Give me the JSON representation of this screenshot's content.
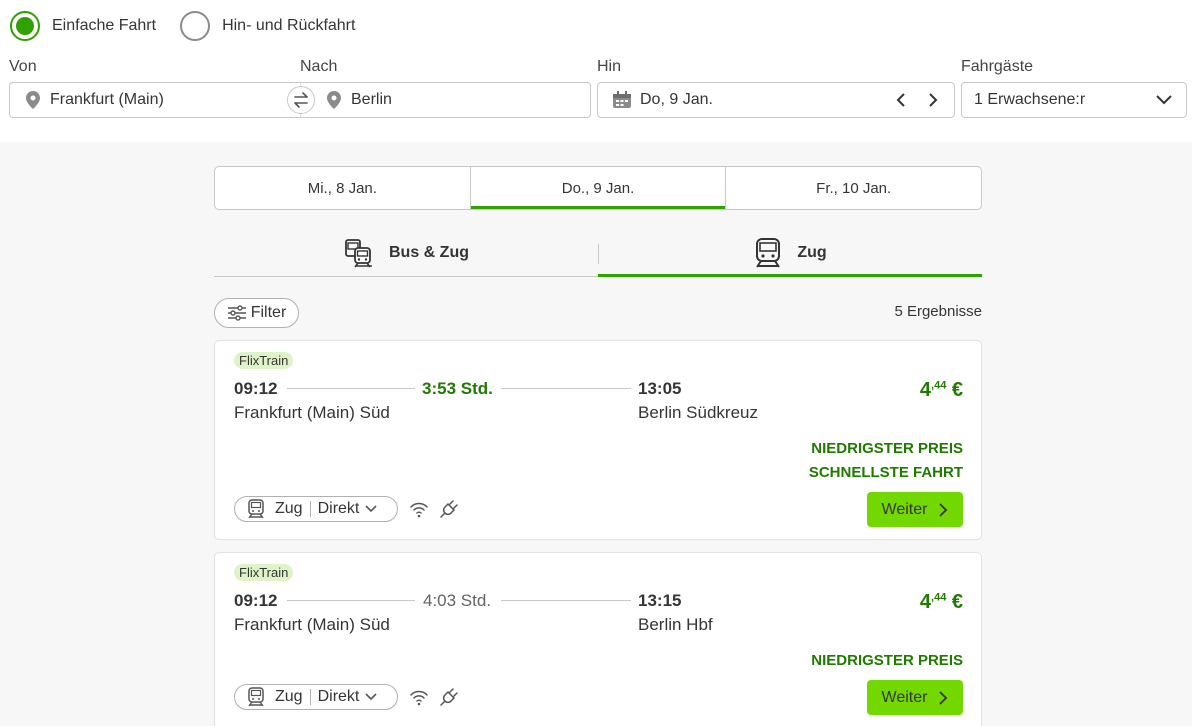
{
  "trip_type": {
    "options": [
      {
        "label": "Einfache Fahrt",
        "checked": true
      },
      {
        "label": "Hin- und Rückfahrt",
        "checked": false
      }
    ]
  },
  "search": {
    "from_label": "Von",
    "from_value": "Frankfurt (Main)",
    "to_label": "Nach",
    "to_value": "Berlin",
    "date_label": "Hin",
    "date_value": "Do, 9 Jan.",
    "passengers_label": "Fahrgäste",
    "passengers_value": "1 Erwachsene:r"
  },
  "day_tabs": [
    {
      "label": "Mi., 8 Jan.",
      "active": false
    },
    {
      "label": "Do., 9 Jan.",
      "active": true
    },
    {
      "label": "Fr., 10 Jan.",
      "active": false
    }
  ],
  "mode_tabs": [
    {
      "label": "Bus & Zug",
      "active": false
    },
    {
      "label": "Zug",
      "active": true
    }
  ],
  "filter_label": "Filter",
  "results_count": "5 Ergebnisse",
  "results": [
    {
      "brand": "FlixTrain",
      "dep_time": "09:12",
      "dep_station": "Frankfurt (Main) Süd",
      "duration": "3:53 Std.",
      "arr_time": "13:05",
      "arr_station": "Berlin Südkreuz",
      "price_main": "4",
      "price_cents": ",44",
      "price_currency": "€",
      "badges": [
        "NIEDRIGSTER PREIS",
        "SCHNELLSTE FAHRT"
      ],
      "mode": "Zug",
      "connection": "Direkt",
      "button": "Weiter"
    },
    {
      "brand": "FlixTrain",
      "dep_time": "09:12",
      "dep_station": "Frankfurt (Main) Süd",
      "duration": "4:03 Std.",
      "arr_time": "13:15",
      "arr_station": "Berlin Hbf",
      "price_main": "4",
      "price_cents": ",44",
      "price_currency": "€",
      "badges": [
        "NIEDRIGSTER PREIS"
      ],
      "mode": "Zug",
      "connection": "Direkt",
      "button": "Weiter"
    }
  ],
  "colors": {
    "accent": "#31a100",
    "price_green": "#217a00",
    "cta": "#73d700",
    "brand_bg": "#dff3c8"
  }
}
